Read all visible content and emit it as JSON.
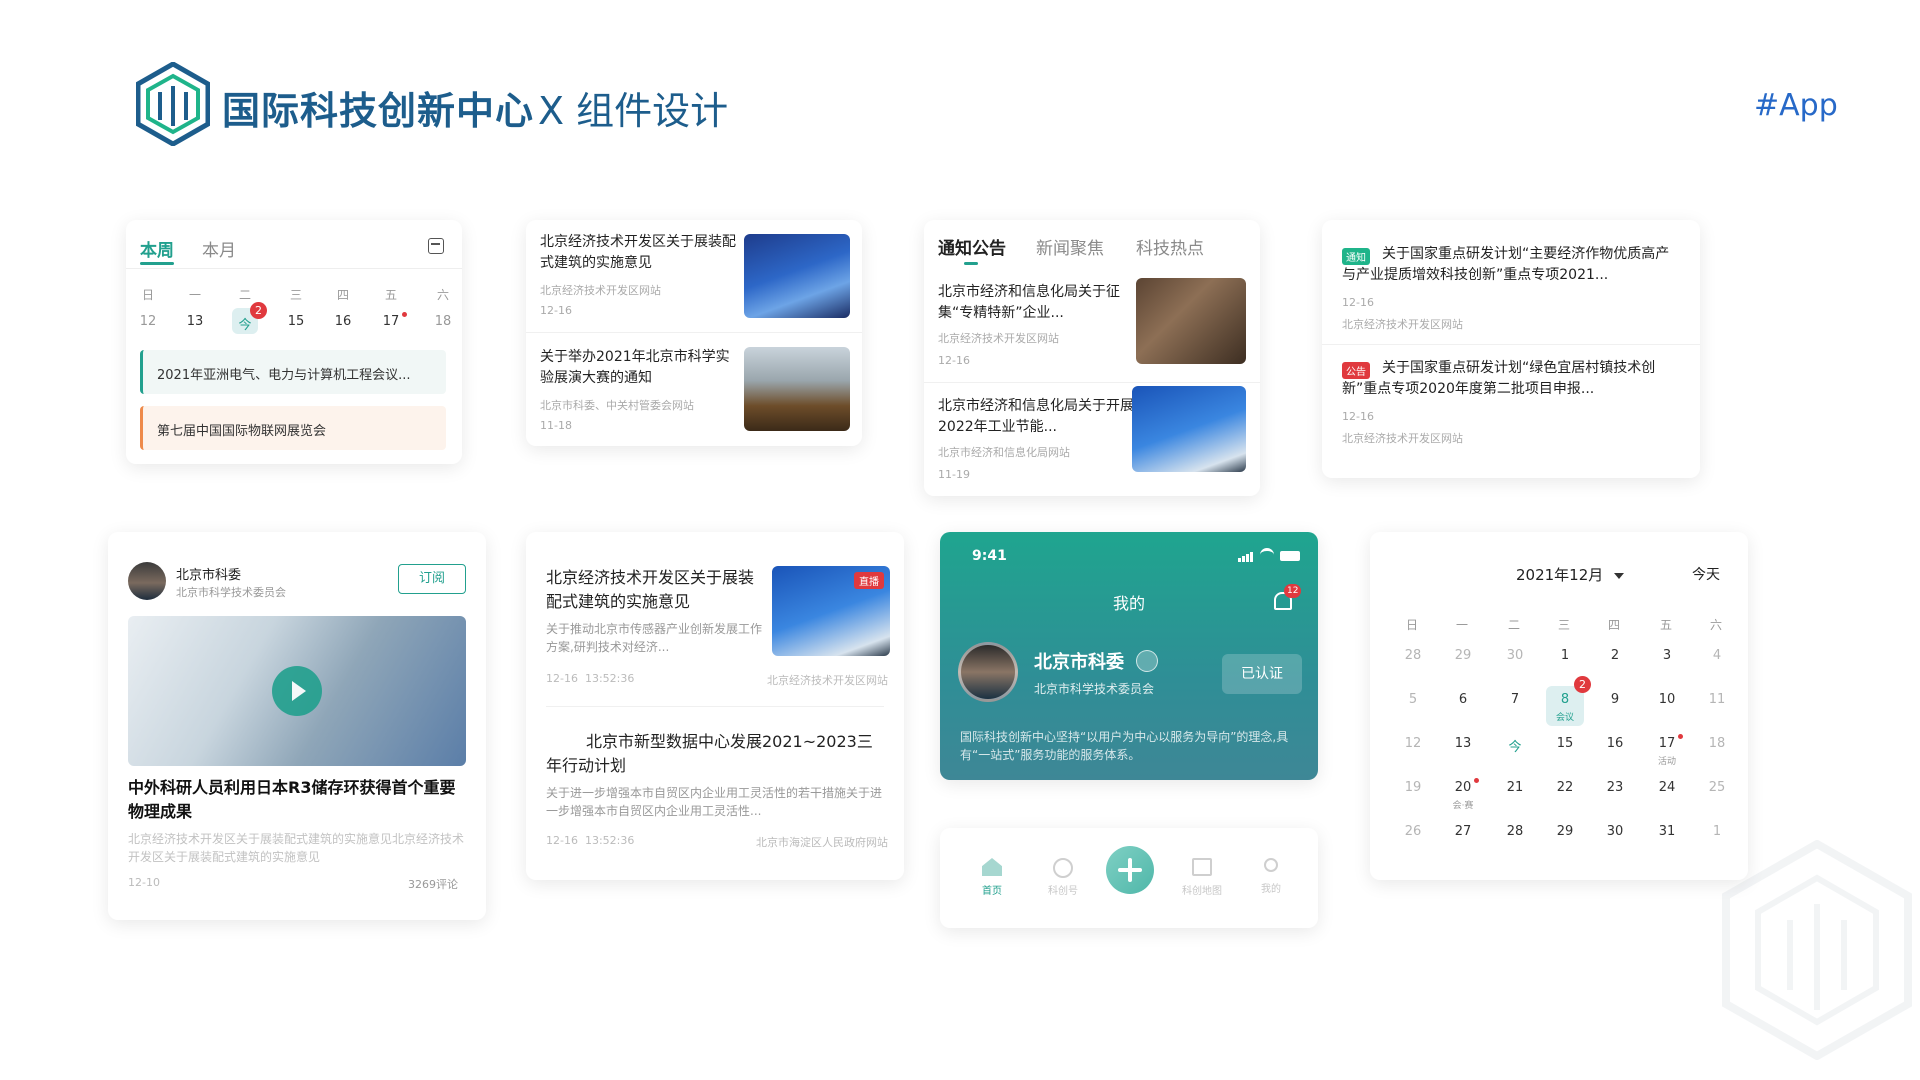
{
  "header": {
    "brand": "国际科技创新中心",
    "subtitle": "X 组件设计",
    "tag": "#App",
    "brand_color": "#1d5d8c"
  },
  "calendar_week": {
    "tabs": [
      "本周",
      "本月"
    ],
    "weekdays": [
      "日",
      "一",
      "二",
      "三",
      "四",
      "五",
      "六"
    ],
    "dates": [
      "12",
      "13",
      "今",
      "15",
      "16",
      "17",
      "18"
    ],
    "today_badge": "2",
    "events": [
      "2021年亚洲电气、电力与计算机工程会议...",
      "第七届中国国际物联网展览会"
    ]
  },
  "news_list_1": {
    "items": [
      {
        "title": "北京经济技术开发区关于展装配式建筑的实施意见",
        "source": "北京经济技术开发区网站",
        "date": "12-16"
      },
      {
        "title": "关于举办2021年北京市科学实验展演大赛的通知",
        "source": "北京市科委、中关村管委会网站",
        "date": "11-18"
      }
    ]
  },
  "notice_tabs": {
    "tabs": [
      "通知公告",
      "新闻聚焦",
      "科技热点"
    ],
    "items": [
      {
        "title": "北京市经济和信息化局关于征集“专精特新”企业...",
        "source": "北京经济技术开发区网站",
        "date": "12-16"
      },
      {
        "title": "北京市经济和信息化局关于开展2022年工业节能...",
        "source": "北京市经济和信息化局网站",
        "date": "11-19"
      }
    ]
  },
  "policy_list": {
    "items": [
      {
        "badge": "通知",
        "badge_color": "#1fb48a",
        "title": "关于国家重点研发计划“主要经济作物优质高产与产业提质增效科技创新”重点专项2021...",
        "date": "12-16",
        "source": "北京经济技术开发区网站"
      },
      {
        "badge": "公告",
        "badge_color": "#e0393e",
        "title": "关于国家重点研发计划“绿色宜居村镇技术创新”重点专项2020年度第二批项目申报...",
        "date": "12-16",
        "source": "北京经济技术开发区网站"
      }
    ]
  },
  "video_card": {
    "author": "北京市科委",
    "org": "北京市科学技术委员会",
    "subscribe": "订阅",
    "title": "中外科研人员利用日本R3储存环获得首个重要物理成果",
    "desc": "北京经济技术开发区关于展装配式建筑的实施意见北京经济技术开发区关于展装配式建筑的实施意见",
    "date": "12-10",
    "comments": "3269评论"
  },
  "news_list_2": {
    "items": [
      {
        "title": "北京经济技术开发区关于展装配式建筑的实施意见",
        "desc": "关于推动北京市传感器产业创新发展工作方案,研判技术对经济...",
        "time": "12-16  13:52:36",
        "source": "北京经济技术开发区网站",
        "badge": "直播"
      },
      {
        "title": "北京市新型数据中心发展2021~2023三年行动计划",
        "desc": "关于进一步增强本市自贸区内企业用工灵活性的若干措施关于进一步增强本市自贸区内企业用工灵活性...",
        "time": "12-16  13:52:36",
        "source": "北京市海淀区人民政府网站"
      }
    ]
  },
  "profile": {
    "time": "9:41",
    "title": "我的",
    "bell_badge": "12",
    "name": "北京市科委",
    "org": "北京市科学技术委员会",
    "verified": "已认证",
    "desc": "国际科技创新中心坚持“以用户为中心以服务为导向”的理念,具有“一站式”服务功能的服务体系。",
    "accent": "#22a08e"
  },
  "tabbar": {
    "items": [
      {
        "label": "首页",
        "icon": "home-icon"
      },
      {
        "label": "科创号",
        "icon": "compass-icon"
      },
      {
        "label": "科创地图",
        "icon": "map-icon"
      },
      {
        "label": "我的",
        "icon": "user-icon"
      }
    ]
  },
  "calendar_month": {
    "title": "2021年12月",
    "today": "今天",
    "weekdays": [
      "日",
      "一",
      "二",
      "三",
      "四",
      "五",
      "六"
    ],
    "rows": [
      [
        "28",
        "29",
        "30",
        "1",
        "2",
        "3",
        "4"
      ],
      [
        "5",
        "6",
        "7",
        "8",
        "9",
        "10",
        "11"
      ],
      [
        "12",
        "13",
        "今",
        "15",
        "16",
        "17",
        "18"
      ],
      [
        "19",
        "20",
        "21",
        "22",
        "23",
        "24",
        "25"
      ],
      [
        "26",
        "27",
        "28",
        "29",
        "30",
        "31",
        "1"
      ]
    ],
    "sel_badge": "2",
    "sel_note": "会议",
    "note_17": "活动",
    "note_20": "会·赛"
  }
}
